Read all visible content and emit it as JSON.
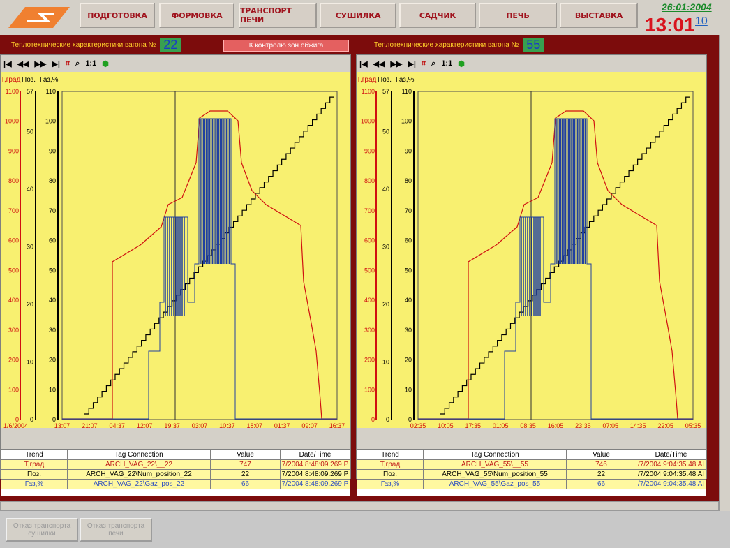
{
  "nav": [
    "ПОДГОТОВКА",
    "ФОРМОВКА",
    "ТРАНСПОРТ ПЕЧИ",
    "СУШИЛКА",
    "САДЧИК",
    "ПЕЧЬ",
    "ВЫСТАВКА"
  ],
  "clock": {
    "date": "26:01:2004",
    "time": "13:01",
    "seconds": "10"
  },
  "header": {
    "left_label": "Теплотехнические характеристики вагона №",
    "left_wagon": "22",
    "center_button": "К контролю зон обжига",
    "right_label": "Теплотехнические характеристики вагона №",
    "right_wagon": "55"
  },
  "toolbar": [
    "|◀",
    "◀◀",
    "▶▶",
    "▶|",
    "⌗",
    "⌕",
    "1:1",
    "⬢"
  ],
  "axis_headers": {
    "t": "Т,град",
    "pos": "Поз.",
    "gas": "Газ,%"
  },
  "left": {
    "x_date": "1/6/2004",
    "x_ticks": [
      "13:07",
      "21:07",
      "04:37",
      "12:07",
      "19:37",
      "03:07",
      "10:37",
      "18:07",
      "01:37",
      "09:07",
      "16:37"
    ],
    "table": {
      "headers": [
        "Trend",
        "Tag Connection",
        "Value",
        "Date/Time"
      ],
      "rows": [
        [
          "Т,град",
          "ARCH_VAG_22\\__22",
          "747",
          "7/2004 8:48:09.269 P"
        ],
        [
          "Поз.",
          "ARCH_VAG_22\\Num_position_22",
          "22",
          "7/2004 8:48:09.269 P"
        ],
        [
          "Газ,%",
          "ARCH_VAG_22\\Gaz_pos_22",
          "66",
          "7/2004 8:48:09.269 P"
        ]
      ]
    }
  },
  "right": {
    "x_date": "",
    "x_ticks": [
      "02:35",
      "10:05",
      "17:35",
      "01:05",
      "08:35",
      "16:05",
      "23:35",
      "07:05",
      "14:35",
      "22:05",
      "05:35"
    ],
    "table": {
      "headers": [
        "Trend",
        "Tag Connection",
        "Value",
        "Date/Time"
      ],
      "rows": [
        [
          "Т,град",
          "ARCH_VAG_55\\__55",
          "746",
          "/7/2004 9:04:35.48 AI"
        ],
        [
          "Поз.",
          "ARCH_VAG_55\\Num_position_55",
          "22",
          "/7/2004 9:04:35.48 AI"
        ],
        [
          "Газ,%",
          "ARCH_VAG_55\\Gaz_pos_55",
          "66",
          "/7/2004 9:04:35.48 AI"
        ]
      ]
    }
  },
  "bottom": [
    "Отказ транспорта сушилки",
    "Отказ транспорта печи"
  ],
  "colors": {
    "temp": "#d01010",
    "gas": "#2040a0",
    "pos": "#000000",
    "plot_bg": "#f8f070",
    "frame": "#7c0c0c"
  }
}
